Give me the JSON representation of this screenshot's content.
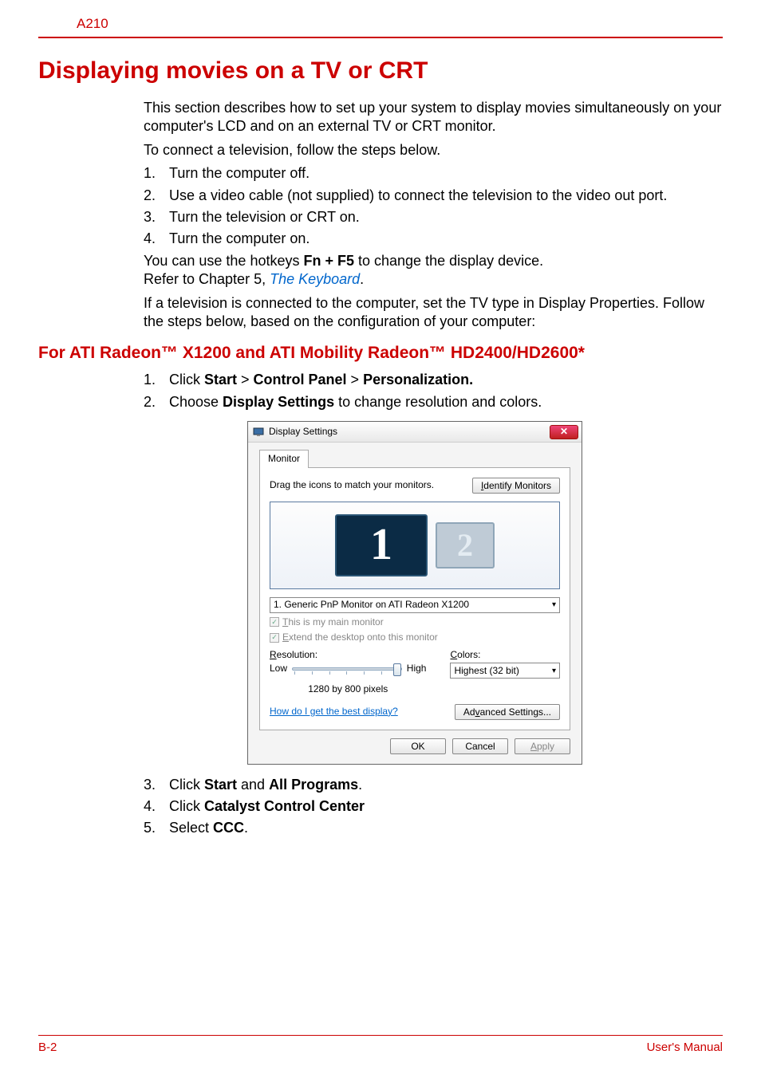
{
  "header": {
    "model": "A210"
  },
  "title": "Displaying movies on a TV or CRT",
  "intro": "This section describes how to set up your system to display movies simultaneously on your computer's LCD and on an external TV or CRT monitor.",
  "connect_intro": "To connect a television, follow the steps below.",
  "steps_a": [
    "Turn the computer off.",
    "Use a video cable (not supplied) to connect the television to the video out port.",
    "Turn the television or CRT on.",
    "Turn the computer on."
  ],
  "hotkeys_line_pre": "You can use the hotkeys ",
  "hotkeys_bold": "Fn + F5",
  "hotkeys_line_post": " to change the display device.",
  "refer_pre": "Refer to Chapter 5, ",
  "refer_link": "The Keyboard",
  "refer_post": ".",
  "tvtype": "If a television is connected to the computer, set the TV type in Display Properties. Follow the steps below, based on the configuration of your computer:",
  "subsection": "For ATI Radeon™ X1200 and ATI Mobility Radeon™ HD2400/HD2600*",
  "steps_b_1_pre": "Click ",
  "steps_b_1_b1": "Start",
  "steps_b_1_gt1": " > ",
  "steps_b_1_b2": "Control Panel",
  "steps_b_1_gt2": " > ",
  "steps_b_1_b3": "Personalization.",
  "steps_b_2_pre": "Choose ",
  "steps_b_2_b": "Display Settings",
  "steps_b_2_post": " to change resolution and colors.",
  "dialog": {
    "title": "Display Settings",
    "tab": "Monitor",
    "drag_text": "Drag the icons to match your monitors.",
    "identify_btn": "Identify Monitors",
    "mon1": "1",
    "mon2": "2",
    "dropdown": "1. Generic PnP Monitor on ATI Radeon X1200",
    "chk1": "This is my main monitor",
    "chk2": "Extend the desktop onto this monitor",
    "res_label": "Resolution:",
    "low": "Low",
    "high": "High",
    "res_value": "1280 by 800 pixels",
    "colors_label": "Colors:",
    "colors_value": "Highest (32 bit)",
    "help": "How do I get the best display?",
    "adv": "Advanced Settings...",
    "ok": "OK",
    "cancel": "Cancel",
    "apply": "Apply"
  },
  "steps_c": {
    "s3_pre": "Click ",
    "s3_b1": "Start",
    "s3_mid": " and ",
    "s3_b2": "All Programs",
    "s3_post": ".",
    "s4_pre": "Click ",
    "s4_b": "Catalyst Control Center",
    "s5_pre": "Select ",
    "s5_b": "CCC",
    "s5_post": "."
  },
  "footer": {
    "left": "B-2",
    "right": "User's Manual"
  }
}
